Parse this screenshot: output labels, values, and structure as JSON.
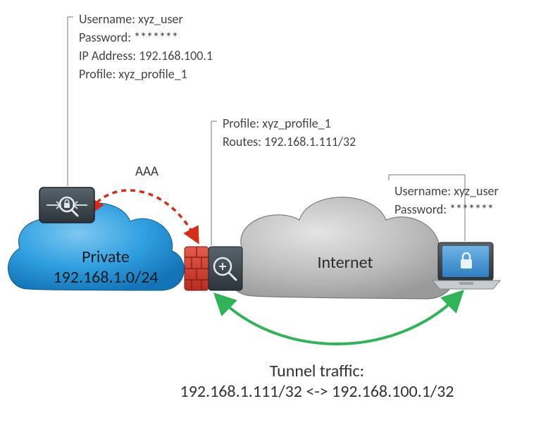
{
  "aaa_server": {
    "username_label": "Username: ",
    "username": "xyz_user",
    "password_label": "Password: ",
    "password": "*******",
    "ip_label": "IP Address: ",
    "ip": "192.168.100.1",
    "profile_label": "Profile: ",
    "profile": "xyz_profile_1"
  },
  "firewall": {
    "profile_label": "Profile: ",
    "profile": "xyz_profile_1",
    "routes_label": "Routes: ",
    "routes": "192.168.1.111/32"
  },
  "client": {
    "username_label": "Username: ",
    "username": "xyz_user",
    "password_label": "Password: ",
    "password": "*******"
  },
  "clouds": {
    "private_name": "Private",
    "private_subnet": "192.168.1.0/24",
    "internet_name": "Internet"
  },
  "link_label": "AAA",
  "tunnel": {
    "title": "Tunnel traffic:",
    "route": "192.168.1.111/32 <-> 192.168.100.1/32"
  }
}
